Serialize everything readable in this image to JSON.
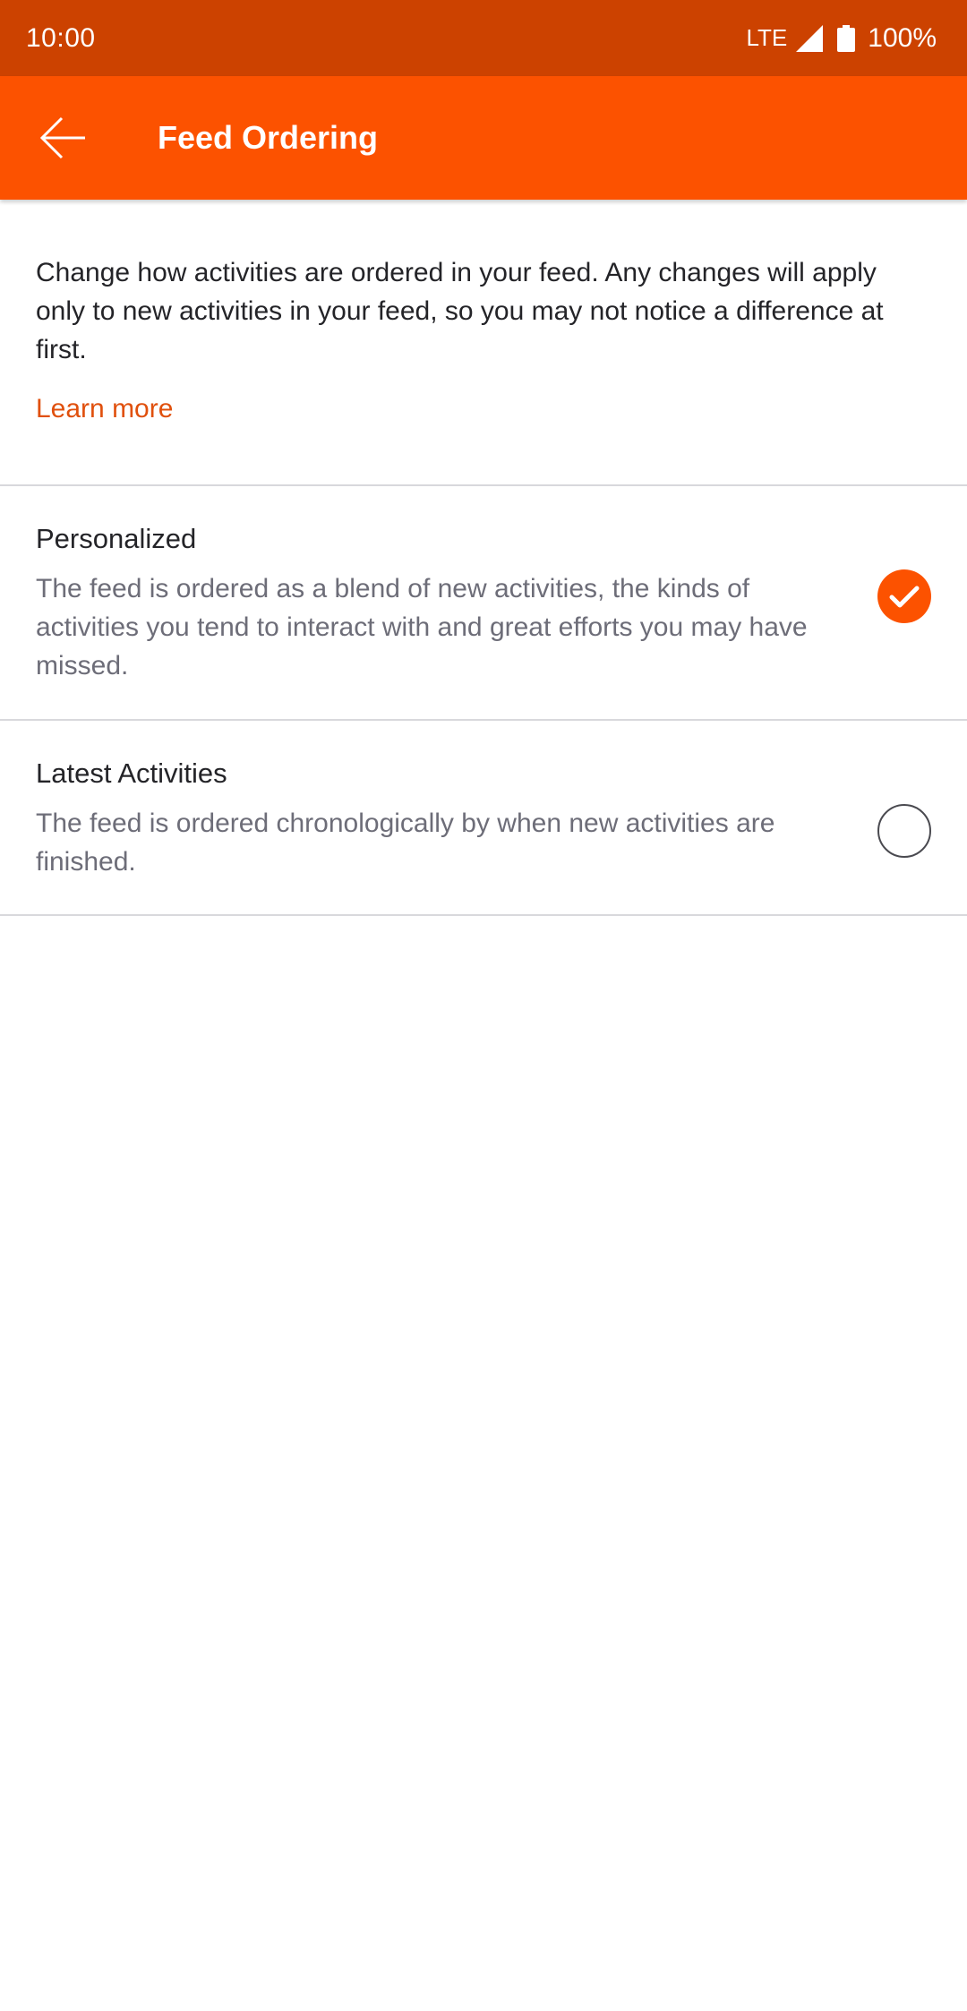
{
  "status_bar": {
    "time": "10:00",
    "network": "LTE",
    "battery": "100%"
  },
  "app_bar": {
    "title": "Feed Ordering",
    "back_icon": "arrow-left-icon"
  },
  "intro": {
    "text": "Change how activities are ordered in your feed. Any changes will apply only to new activities in your feed, so you may not notice a difference at first.",
    "learn_more": "Learn more"
  },
  "options": [
    {
      "title": "Personalized",
      "description": "The feed is ordered as a blend of new activities, the kinds of activities you tend to interact with and great efforts you may have missed.",
      "selected": true
    },
    {
      "title": "Latest Activities",
      "description": "The feed is ordered chronologically by when new activities are finished.",
      "selected": false
    }
  ],
  "colors": {
    "accent": "#fc5200",
    "status_bar": "#cc4200",
    "link": "#e0500d"
  }
}
